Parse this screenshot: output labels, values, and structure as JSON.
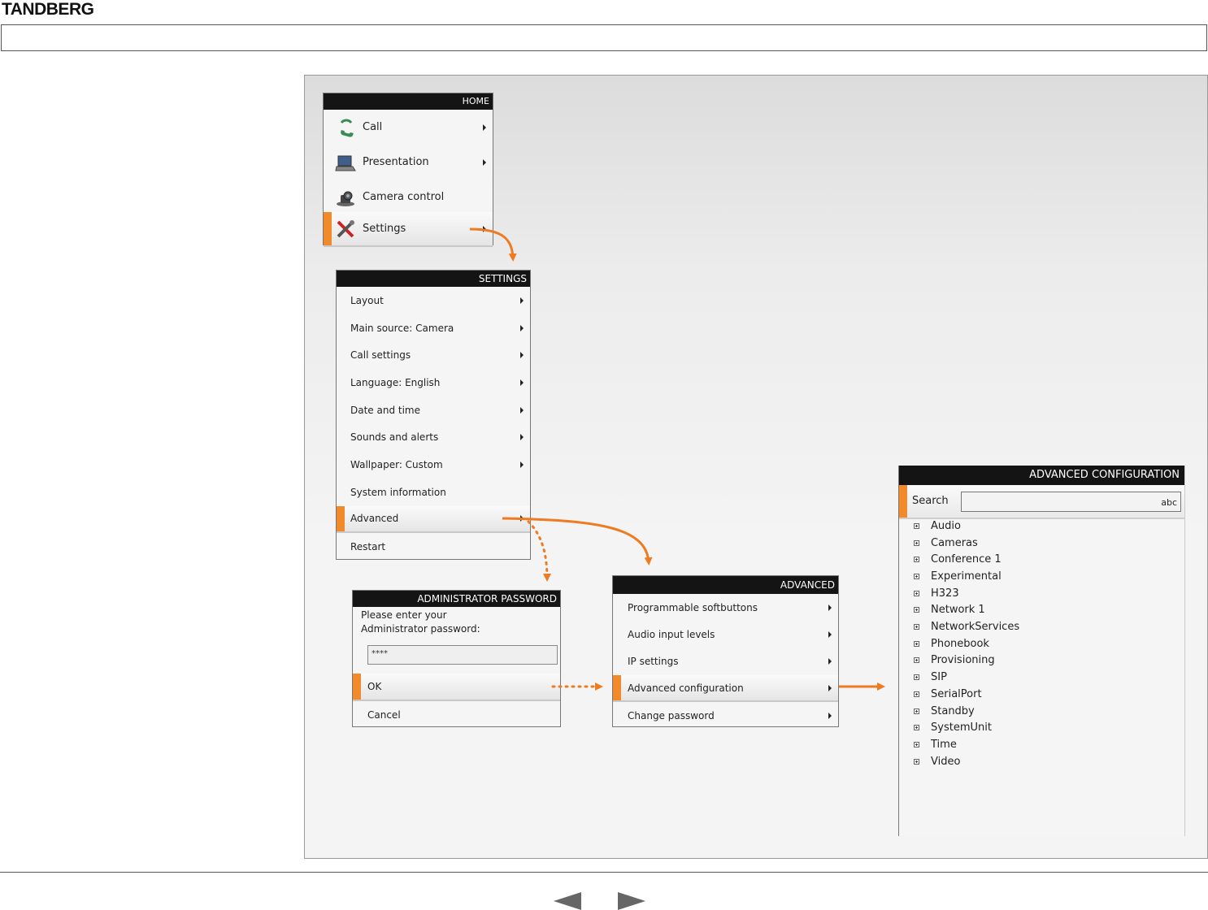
{
  "brand": "TANDBERG",
  "accent_color": "#f08a2a",
  "home": {
    "header": "HOME",
    "items": [
      {
        "label": "Call",
        "icon": "phone-icon",
        "submenu": true
      },
      {
        "label": "Presentation",
        "icon": "laptop-icon",
        "submenu": true
      },
      {
        "label": "Camera control",
        "icon": "camera-icon",
        "submenu": false
      },
      {
        "label": "Settings",
        "icon": "tools-icon",
        "submenu": true,
        "selected": true
      }
    ]
  },
  "settings": {
    "header": "SETTINGS",
    "items": [
      {
        "label": "Layout",
        "submenu": true
      },
      {
        "label": "Main source: Camera",
        "submenu": true
      },
      {
        "label": "Call settings",
        "submenu": true
      },
      {
        "label": "Language: English",
        "submenu": true
      },
      {
        "label": "Date and time",
        "submenu": true
      },
      {
        "label": "Sounds and alerts",
        "submenu": true
      },
      {
        "label": "Wallpaper: Custom",
        "submenu": true
      },
      {
        "label": "System information",
        "submenu": false
      },
      {
        "label": "Advanced",
        "submenu": true,
        "selected": true
      },
      {
        "label": "Restart",
        "submenu": false
      }
    ]
  },
  "admin_password": {
    "header": "ADMINISTRATOR PASSWORD",
    "prompt_line1": "Please enter your",
    "prompt_line2": "Administrator password:",
    "password_value": "****",
    "ok_label": "OK",
    "cancel_label": "Cancel"
  },
  "advanced": {
    "header": "ADVANCED",
    "items": [
      {
        "label": "Programmable softbuttons",
        "submenu": true
      },
      {
        "label": "Audio input levels",
        "submenu": true
      },
      {
        "label": "IP settings",
        "submenu": true
      },
      {
        "label": "Advanced configuration",
        "submenu": true,
        "selected": true
      },
      {
        "label": "Change password",
        "submenu": true
      }
    ]
  },
  "advanced_configuration": {
    "header": "ADVANCED CONFIGURATION",
    "search_label": "Search",
    "search_value": "abc",
    "tree": [
      "Audio",
      "Cameras",
      "Conference 1",
      "Experimental",
      "H323",
      "Network 1",
      "NetworkServices",
      "Phonebook",
      "Provisioning",
      "SIP",
      "SerialPort",
      "Standby",
      "SystemUnit",
      "Time",
      "Video"
    ]
  }
}
